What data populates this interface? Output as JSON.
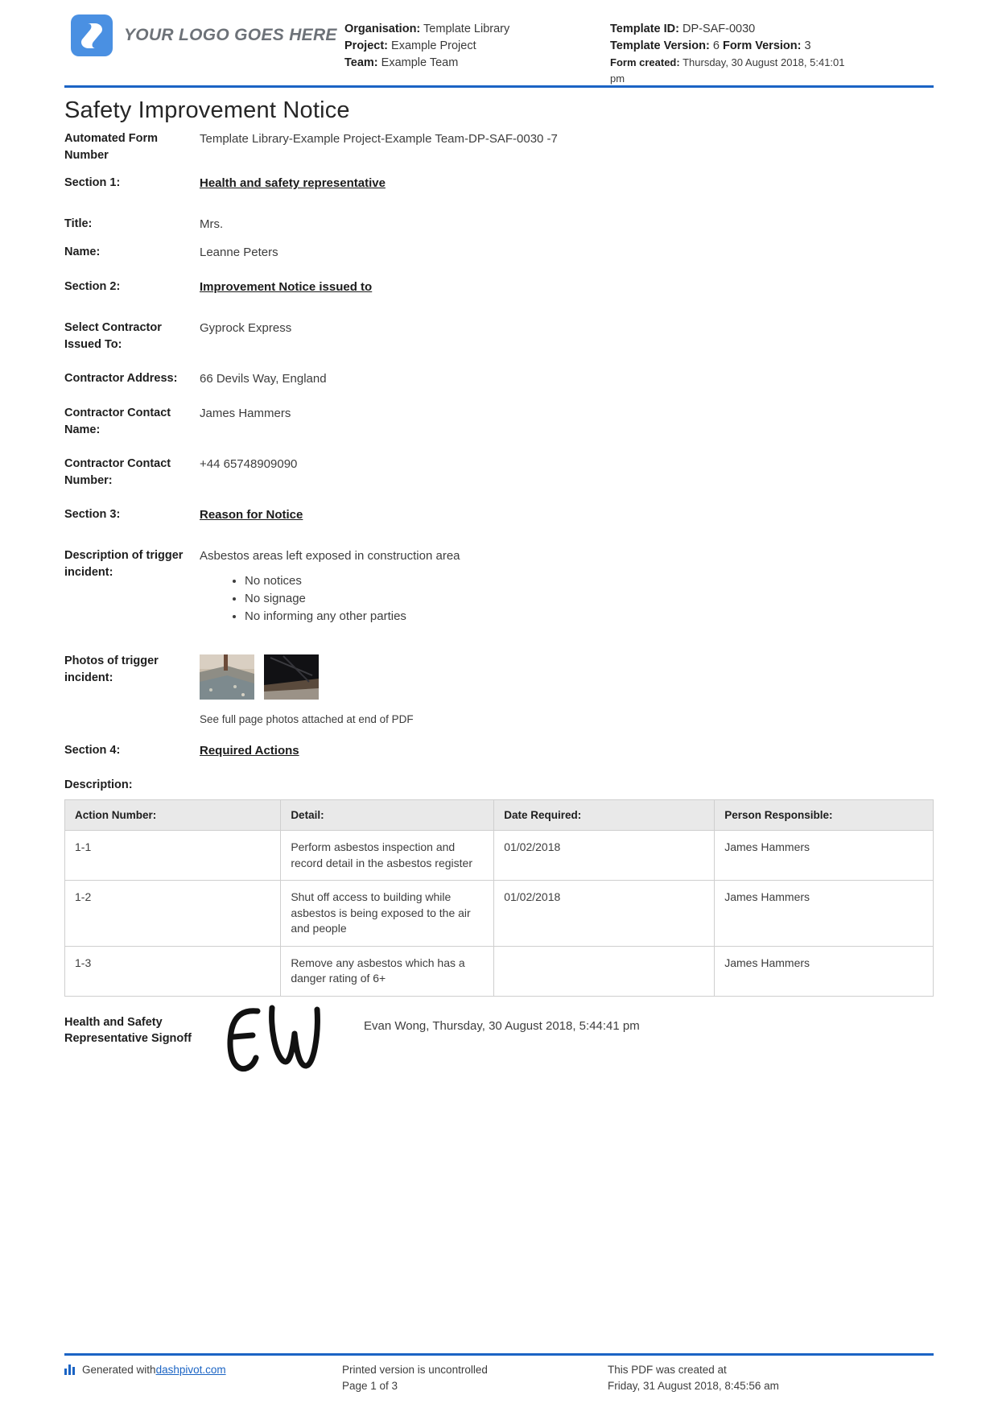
{
  "header": {
    "logo_text": "YOUR LOGO GOES HERE",
    "logo_color": "#4a90e2",
    "accent_color": "#1b64c4",
    "organisation_label": "Organisation:",
    "organisation_value": "Template Library",
    "project_label": "Project:",
    "project_value": "Example Project",
    "team_label": "Team:",
    "team_value": "Example Team",
    "template_id_label": "Template ID:",
    "template_id_value": "DP-SAF-0030",
    "template_version_label": "Template Version:",
    "template_version_value": "6",
    "form_version_label": "Form Version:",
    "form_version_value": "3",
    "form_created_label": "Form created:",
    "form_created_value": "Thursday, 30 August 2018, 5:41:01 pm"
  },
  "document": {
    "title": "Safety Improvement Notice",
    "automated_form_number_label": "Automated Form Number",
    "automated_form_number_value": "Template Library-Example Project-Example Team-DP-SAF-0030   -7"
  },
  "sections": {
    "s1_label": "Section 1:",
    "s1_title": "Health and safety representative",
    "title_label": "Title:",
    "title_value": "Mrs.",
    "name_label": "Name:",
    "name_value": "Leanne Peters",
    "s2_label": "Section 2:",
    "s2_title": "Improvement Notice issued to",
    "contractor_select_label": "Select Contractor Issued To:",
    "contractor_select_value": "Gyprock Express",
    "contractor_address_label": "Contractor Address:",
    "contractor_address_value": "66 Devils Way, England",
    "contractor_contact_name_label": "Contractor Contact Name:",
    "contractor_contact_name_value": "James Hammers",
    "contractor_contact_number_label": "Contractor Contact Number:",
    "contractor_contact_number_value": "+44 65748909090",
    "s3_label": "Section 3:",
    "s3_title": "Reason for Notice",
    "trigger_description_label": "Description of trigger incident:",
    "trigger_description_value": "Asbestos areas left exposed in construction area",
    "trigger_bullets": [
      "No notices",
      "No signage",
      "No informing any other parties"
    ],
    "photos_label": "Photos of trigger incident:",
    "photos_caption": "See full page photos attached at end of PDF",
    "s4_label": "Section 4:",
    "s4_title": "Required Actions",
    "description_label": "Description:"
  },
  "actions_table": {
    "columns": [
      "Action Number:",
      "Detail:",
      "Date Required:",
      "Person Responsible:"
    ],
    "rows": [
      {
        "action_number": "1-1",
        "detail": "Perform asbestos inspection and record detail in the asbestos register",
        "date_required": "01/02/2018",
        "person_responsible": "James Hammers"
      },
      {
        "action_number": "1-2",
        "detail": "Shut off access to building while asbestos is being exposed to the air and people",
        "date_required": "01/02/2018",
        "person_responsible": "James Hammers"
      },
      {
        "action_number": "1-3",
        "detail": "Remove any asbestos which has a danger rating of 6+",
        "date_required": "",
        "person_responsible": "James Hammers"
      }
    ]
  },
  "signoff": {
    "label": "Health and Safety Representative Signoff",
    "signature_initials": "E W",
    "value": "Evan Wong, Thursday, 30 August 2018, 5:44:41 pm"
  },
  "footer": {
    "generated_prefix": "Generated with ",
    "generated_link": "dashpivot.com",
    "printed_notice": "Printed version is uncontrolled",
    "page_indicator": "Page 1 of 3",
    "pdf_created_label": "This PDF was created at",
    "pdf_created_value": "Friday, 31 August 2018, 8:45:56 am"
  }
}
